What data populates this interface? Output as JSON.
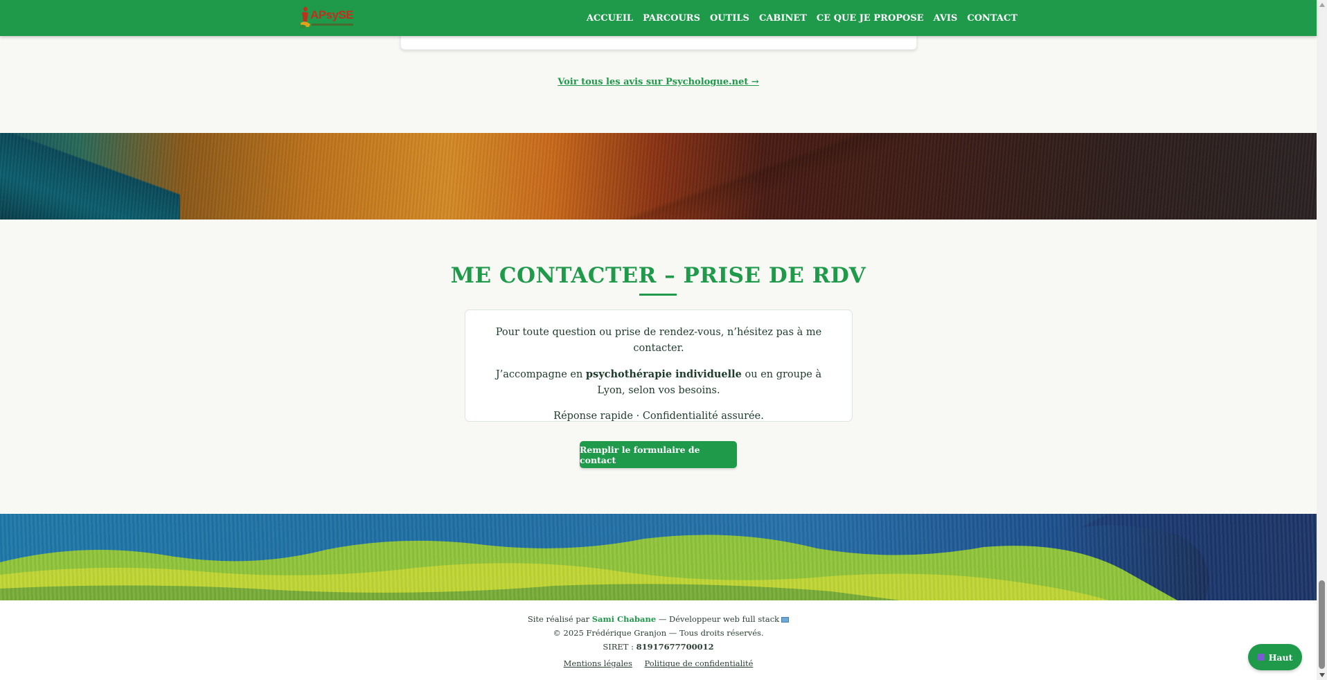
{
  "nav": {
    "logo_text": "APsySE",
    "items": [
      "ACCUEIL",
      "PARCOURS",
      "OUTILS",
      "CABINET",
      "CE QUE JE PROPOSE",
      "AVIS",
      "CONTACT"
    ]
  },
  "reviews": {
    "link_label": "Voir tous les avis sur Psychologue.net →"
  },
  "contact": {
    "title": "ME CONTACTER – PRISE DE RDV",
    "line1": "Pour toute question ou prise de rendez-vous, n’hésitez pas à me contacter.",
    "line2_pre": "J’accompagne en ",
    "line2_bold": "psychothérapie individuelle",
    "line2_post": " ou en groupe à Lyon, selon vos besoins.",
    "line3": "Réponse rapide · Confidentialité assurée.",
    "cta_label": "Remplir le formulaire de contact"
  },
  "footer": {
    "credit_pre": "Site réalisé par ",
    "credit_name": "Sami Chabane",
    "credit_post": " — Développeur web full stack",
    "copyright": "© 2025 Frédérique Granjon — Tous droits réservés.",
    "siret_label": "SIRET : ",
    "siret_value": "81917677700012",
    "legal_link": "Mentions légales",
    "privacy_link": "Politique de confidentialité"
  },
  "back_to_top": {
    "label": "Haut",
    "icon": "rocket-icon"
  },
  "colors": {
    "brand_green": "#1f9a4b",
    "logo_red": "#c0301c"
  }
}
